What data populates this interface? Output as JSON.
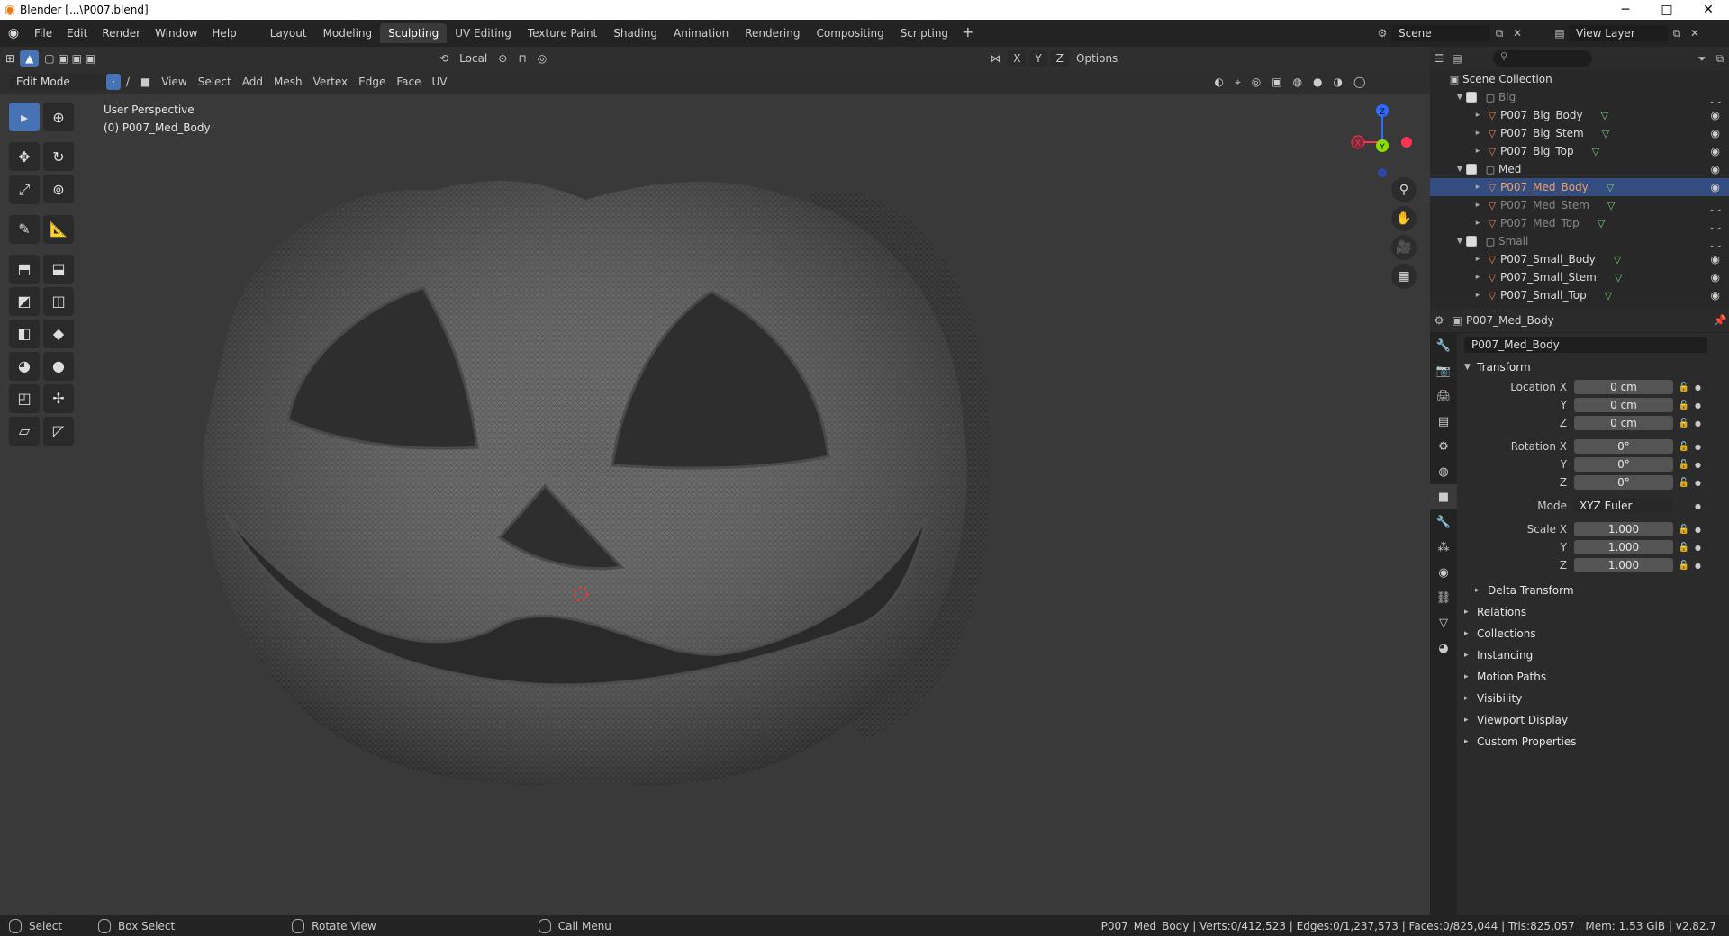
{
  "titlebar": {
    "title": "Blender [...\\P007.blend]",
    "minimize": "─",
    "maximize": "□",
    "close": "✕"
  },
  "menu": [
    "File",
    "Edit",
    "Render",
    "Window",
    "Help"
  ],
  "workspaces": [
    "Layout",
    "Modeling",
    "Sculpting",
    "UV Editing",
    "Texture Paint",
    "Shading",
    "Animation",
    "Rendering",
    "Compositing",
    "Scripting"
  ],
  "active_workspace": "Sculpting",
  "scene": {
    "label": "Scene",
    "view_layer": "View Layer"
  },
  "viewport": {
    "transform_orientation": "Local",
    "options_label": "Options",
    "axes": [
      "X",
      "Y",
      "Z"
    ],
    "mode": "Edit Mode",
    "header_menus": [
      "View",
      "Select",
      "Add",
      "Mesh",
      "Vertex",
      "Edge",
      "Face",
      "UV"
    ],
    "perspective": "User Perspective",
    "object_info": "(0) P007_Med_Body",
    "gizmo_labels": {
      "x": "X",
      "y": "Y",
      "z": "Z"
    }
  },
  "outliner": {
    "root": "Scene Collection",
    "collections": [
      {
        "name": "Big",
        "dim": true,
        "objects": [
          "P007_Big_Body",
          "P007_Big_Stem",
          "P007_Big_Top"
        ]
      },
      {
        "name": "Med",
        "dim": false,
        "objects": [
          "P007_Med_Body",
          "P007_Med_Stem",
          "P007_Med_Top"
        ]
      },
      {
        "name": "Small",
        "dim": true,
        "objects": [
          "P007_Small_Body",
          "P007_Small_Stem",
          "P007_Small_Top"
        ]
      }
    ],
    "selected": "P007_Med_Body"
  },
  "properties": {
    "object_name": "P007_Med_Body",
    "datablock": "P007_Med_Body",
    "transform_title": "Transform",
    "location": {
      "label": "Location X",
      "x": "0 cm",
      "y": "0 cm",
      "z": "0 cm"
    },
    "rotation": {
      "label": "Rotation X",
      "x": "0°",
      "y": "0°",
      "z": "0°"
    },
    "mode_label": "Mode",
    "mode_value": "XYZ Euler",
    "scale": {
      "label": "Scale X",
      "x": "1.000",
      "y": "1.000",
      "z": "1.000"
    },
    "axis_y": "Y",
    "axis_z": "Z",
    "delta_transform": "Delta Transform",
    "panels": [
      "Relations",
      "Collections",
      "Instancing",
      "Motion Paths",
      "Visibility",
      "Viewport Display",
      "Custom Properties"
    ]
  },
  "statusbar": {
    "hints": [
      "Select",
      "Box Select",
      "Rotate View",
      "Call Menu"
    ],
    "stats": "P007_Med_Body | Verts:0/412,523 | Edges:0/1,237,573 | Faces:0/825,044 | Tris:825,057 | Mem: 1.53 GiB | v2.82.7"
  }
}
